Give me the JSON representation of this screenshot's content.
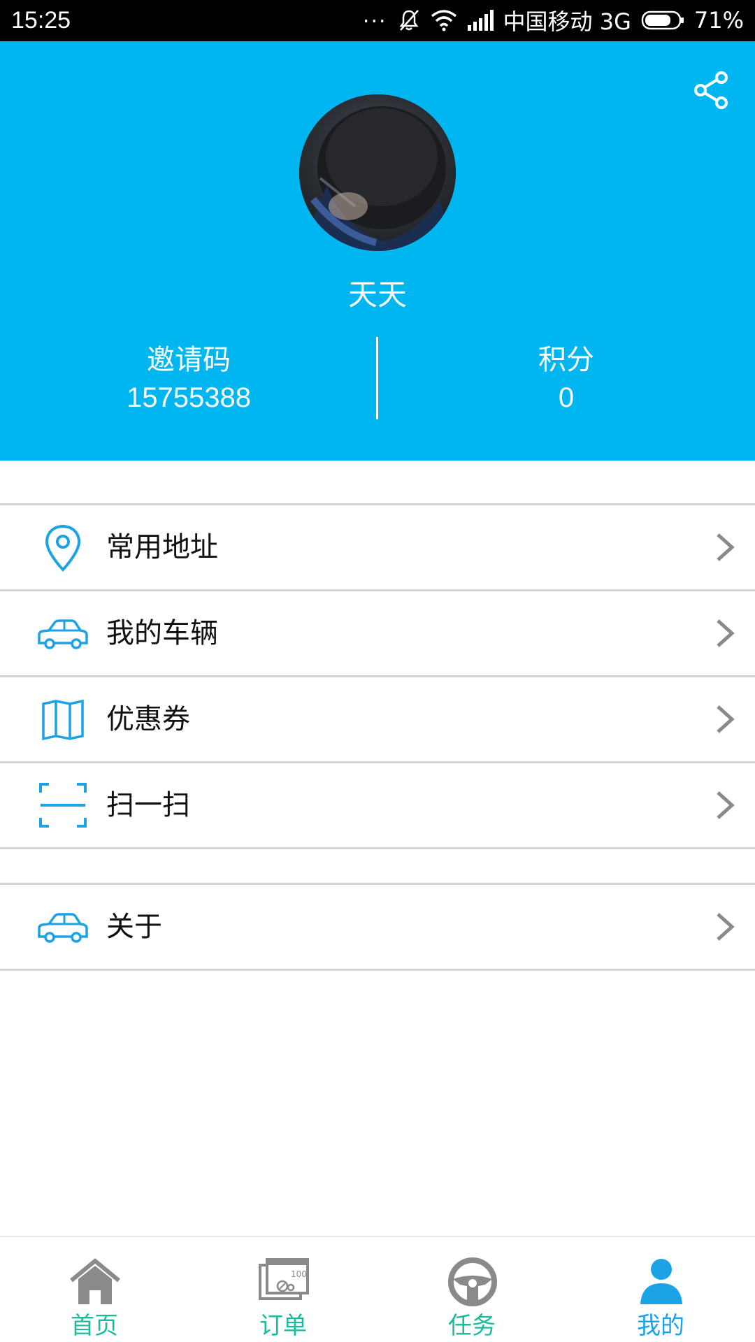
{
  "status_bar": {
    "time": "15:25",
    "carrier": "中国移动 3G",
    "battery": "71%",
    "dots": "..."
  },
  "profile": {
    "username": "天天",
    "invite_label": "邀请码",
    "invite_code": "15755388",
    "points_label": "积分",
    "points_value": "0"
  },
  "menu": {
    "group1": [
      {
        "label": "常用地址",
        "icon": "location-pin-icon"
      },
      {
        "label": "我的车辆",
        "icon": "car-icon"
      },
      {
        "label": "优惠券",
        "icon": "map-icon"
      },
      {
        "label": "扫一扫",
        "icon": "scan-icon"
      }
    ],
    "group2": [
      {
        "label": "关于",
        "icon": "car-icon"
      }
    ]
  },
  "bottom_nav": [
    {
      "label": "首页",
      "icon": "home-icon",
      "active": false
    },
    {
      "label": "订单",
      "icon": "order-icon",
      "active": false
    },
    {
      "label": "任务",
      "icon": "steering-wheel-icon",
      "active": false
    },
    {
      "label": "我的",
      "icon": "person-icon",
      "active": true
    }
  ],
  "colors": {
    "accent": "#00b6f0",
    "nav_label": "#1abc9c",
    "nav_active": "#1ba3e6",
    "nav_icon": "#8a8a8a",
    "divider": "#d4d4d4"
  }
}
